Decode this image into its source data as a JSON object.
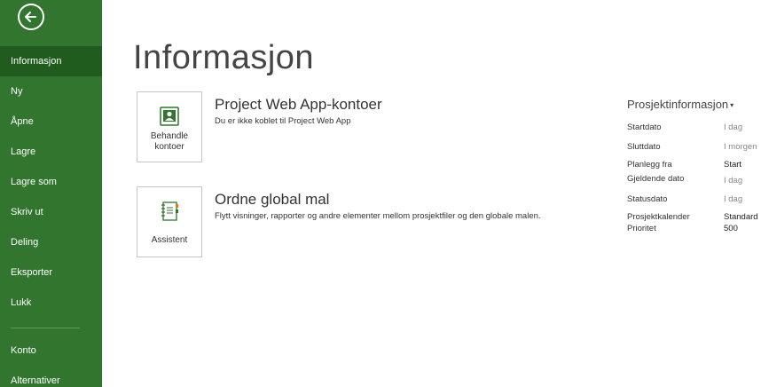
{
  "sidebar": {
    "items": [
      {
        "label": "Informasjon"
      },
      {
        "label": "Ny"
      },
      {
        "label": "Åpne"
      },
      {
        "label": "Lagre"
      },
      {
        "label": "Lagre som"
      },
      {
        "label": "Skriv ut"
      },
      {
        "label": "Deling"
      },
      {
        "label": "Eksporter"
      },
      {
        "label": "Lukk"
      },
      {
        "label": "Konto"
      },
      {
        "label": "Alternativer"
      }
    ],
    "active": "Informasjon",
    "color": "#31752f"
  },
  "page": {
    "title": "Informasjon"
  },
  "sections": [
    {
      "button_label": "Behandle kontoer",
      "title": "Project Web App-kontoer",
      "description": "Du er ikke koblet til Project Web App"
    },
    {
      "button_label": "Assistent",
      "title": "Ordne global mal",
      "description": "Flytt visninger, rapporter og andre elementer mellom prosjektfiler og den globale malen."
    }
  ],
  "project_info": {
    "title": "Prosjektinformasjon",
    "rows": [
      {
        "label": "Startdato",
        "value": "I dag"
      },
      {
        "label": "Sluttdato",
        "value": "I morgen"
      },
      {
        "label": "Planlegg fra",
        "value": "Start"
      },
      {
        "label": "Gjeldende dato",
        "value": "I dag"
      },
      {
        "label": "Statusdato",
        "value": "I dag"
      },
      {
        "label": "Prosjektkalender",
        "value": "Standard"
      },
      {
        "label": "Prioritet",
        "value": "500"
      }
    ]
  }
}
